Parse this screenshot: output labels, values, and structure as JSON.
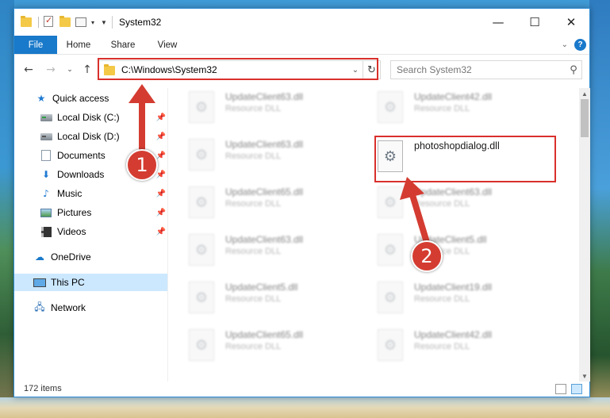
{
  "window": {
    "title": "System32",
    "controls": {
      "minimize": "—",
      "maximize": "☐",
      "close": "✕"
    }
  },
  "ribbon": {
    "tabs": [
      "File",
      "Home",
      "Share",
      "View"
    ]
  },
  "address_bar": {
    "path": "C:\\Windows\\System32",
    "search_placeholder": "Search System32"
  },
  "sidebar": {
    "items": [
      {
        "label": "Quick access",
        "icon": "star-icon"
      },
      {
        "label": "Local Disk (C:)",
        "icon": "drive-icon",
        "pinned": true
      },
      {
        "label": "Local Disk (D:)",
        "icon": "drive-icon",
        "pinned": true
      },
      {
        "label": "Documents",
        "icon": "documents-icon",
        "pinned": true
      },
      {
        "label": "Downloads",
        "icon": "downloads-icon",
        "pinned": true
      },
      {
        "label": "Music",
        "icon": "music-icon",
        "pinned": true
      },
      {
        "label": "Pictures",
        "icon": "pictures-icon",
        "pinned": true
      },
      {
        "label": "Videos",
        "icon": "videos-icon",
        "pinned": true
      },
      {
        "label": "OneDrive",
        "icon": "onedrive-icon"
      },
      {
        "label": "This PC",
        "icon": "this-pc-icon",
        "selected": true
      },
      {
        "label": "Network",
        "icon": "network-icon"
      }
    ]
  },
  "files": {
    "left_column": [
      {
        "name": "UpdateClient63.dll",
        "type": "Resource DLL"
      },
      {
        "name": "UpdateClient63.dll",
        "type": "Resource DLL"
      },
      {
        "name": "UpdateClient65.dll",
        "type": "Resource DLL"
      },
      {
        "name": "UpdateClient63.dll",
        "type": "Resource DLL"
      },
      {
        "name": "UpdateClient5.dll",
        "type": "Resource DLL"
      },
      {
        "name": "UpdateClient65.dll",
        "type": "Resource DLL"
      }
    ],
    "right_column": [
      {
        "name": "UpdateClient42.dll",
        "type": "Resource DLL"
      },
      {
        "name": "photoshopdialog.dll",
        "type": ""
      },
      {
        "name": "UpdateClient63.dll",
        "type": "Resource DLL"
      },
      {
        "name": "UpdateClient5.dll",
        "type": "Resource DLL"
      },
      {
        "name": "UpdateClient19.dll",
        "type": "Resource DLL"
      },
      {
        "name": "UpdateClient42.dll",
        "type": "Resource DLL"
      }
    ]
  },
  "status": {
    "item_count": "172 items"
  },
  "annotations": {
    "badge1": "1",
    "badge2": "2",
    "color": "#d9302c"
  }
}
